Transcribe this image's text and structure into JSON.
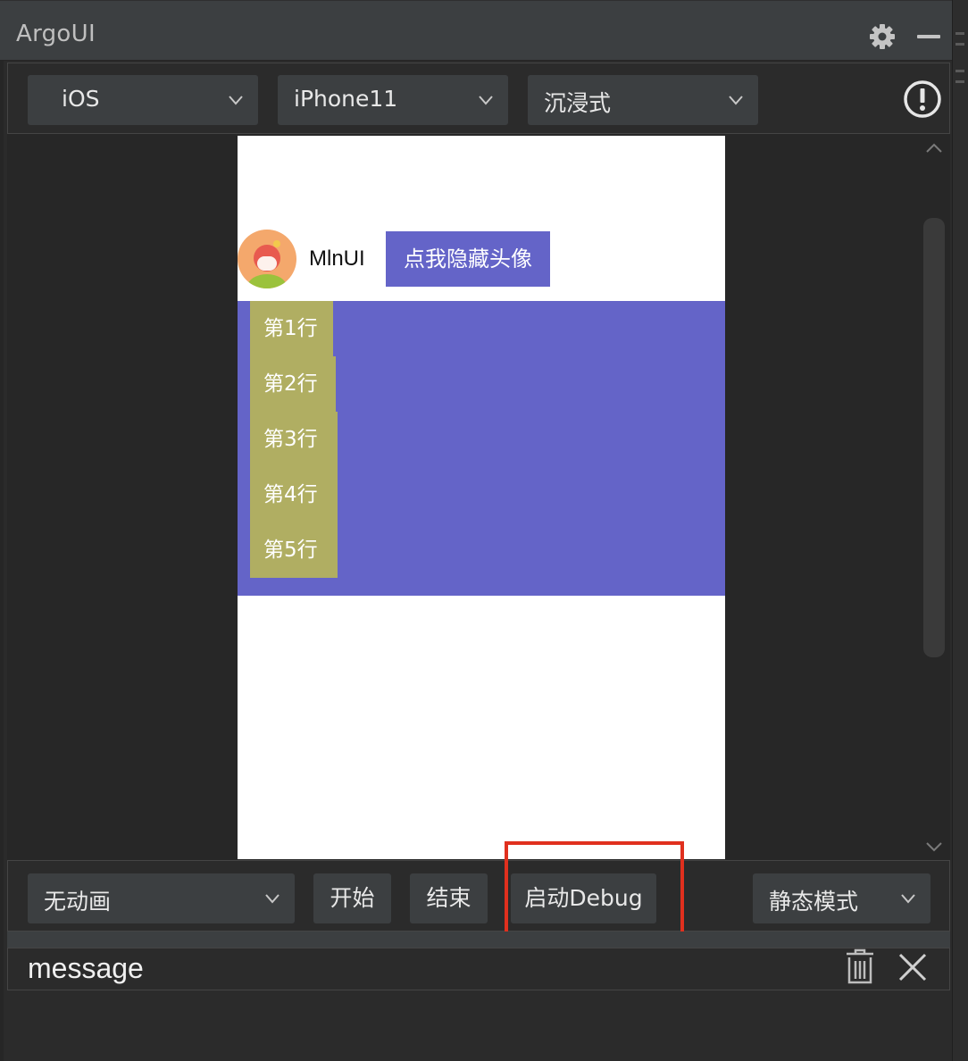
{
  "window": {
    "title": "ArgoUI"
  },
  "toolbar": {
    "platform": "iOS",
    "device": "iPhone11",
    "mode": "沉浸式"
  },
  "preview": {
    "name": "MlnUI",
    "hide_button": "点我隐藏头像",
    "rows": [
      "第1行",
      "第2行",
      "第3行",
      "第4行",
      "第5行"
    ]
  },
  "bottom": {
    "animation": "无动画",
    "start": "开始",
    "end": "结束",
    "debug": "启动Debug",
    "mode": "静态模式"
  },
  "message": {
    "label": "message"
  },
  "colors": {
    "highlight": "#e0301e",
    "purple": "#6464c8",
    "row_olive": "#b0ae62",
    "avatar_bg": "#f4a86c"
  }
}
